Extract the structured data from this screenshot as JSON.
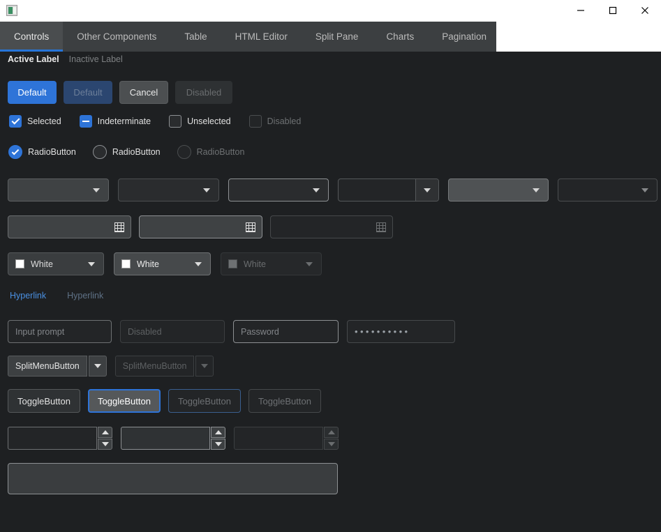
{
  "window": {
    "title": "",
    "icon": "app-window-icon",
    "controls": {
      "minimize": "─",
      "maximize": "□",
      "close": "✕"
    }
  },
  "tabs": [
    {
      "label": "Controls",
      "active": true
    },
    {
      "label": "Other Components",
      "active": false
    },
    {
      "label": "Table",
      "active": false
    },
    {
      "label": "HTML Editor",
      "active": false
    },
    {
      "label": "Split Pane",
      "active": false
    },
    {
      "label": "Charts",
      "active": false
    },
    {
      "label": "Pagination",
      "active": false
    }
  ],
  "labels": {
    "active": "Active Label",
    "inactive": "Inactive Label"
  },
  "buttons": [
    {
      "label": "Default",
      "state": "default"
    },
    {
      "label": "Default",
      "state": "default-disabled"
    },
    {
      "label": "Cancel",
      "state": "cancel"
    },
    {
      "label": "Disabled",
      "state": "disabled"
    }
  ],
  "checkboxes": [
    {
      "label": "Selected",
      "state": "checked"
    },
    {
      "label": "Indeterminate",
      "state": "indeterminate"
    },
    {
      "label": "Unselected",
      "state": "unchecked"
    },
    {
      "label": "Disabled",
      "state": "disabled"
    }
  ],
  "radios": [
    {
      "label": "RadioButton",
      "state": "checked"
    },
    {
      "label": "RadioButton",
      "state": "unchecked"
    },
    {
      "label": "RadioButton",
      "state": "disabled"
    }
  ],
  "combos": [
    {
      "value": "",
      "state": "normal"
    },
    {
      "value": "",
      "state": "flat"
    },
    {
      "value": "",
      "state": "focused"
    },
    {
      "value": "",
      "state": "editable"
    },
    {
      "value": "",
      "state": "hover"
    },
    {
      "value": "",
      "state": "disabled"
    }
  ],
  "datepickers": [
    {
      "value": "",
      "icon": "calendar-icon",
      "state": "normal"
    },
    {
      "value": "",
      "icon": "calendar-icon",
      "state": "focused"
    },
    {
      "value": "",
      "icon": "calendar-icon",
      "state": "disabled"
    }
  ],
  "colorpickers": [
    {
      "value": "White",
      "swatch": "#ffffff",
      "state": "normal"
    },
    {
      "value": "White",
      "swatch": "#ffffff",
      "state": "hover"
    },
    {
      "value": "White",
      "swatch": "#6e7173",
      "state": "disabled"
    }
  ],
  "hyperlinks": [
    {
      "label": "Hyperlink",
      "state": "enabled"
    },
    {
      "label": "Hyperlink",
      "state": "disabled"
    }
  ],
  "textfields": [
    {
      "value": "",
      "placeholder": "Input prompt",
      "state": "normal"
    },
    {
      "value": "",
      "placeholder": "Disabled",
      "state": "disabled"
    },
    {
      "value": "",
      "placeholder": "Password",
      "state": "focused"
    },
    {
      "value": "••••••••••",
      "placeholder": "",
      "state": "password"
    }
  ],
  "splitmenubuttons": [
    {
      "label": "SplitMenuButton",
      "state": "enabled"
    },
    {
      "label": "SplitMenuButton",
      "state": "disabled"
    }
  ],
  "togglebuttons": [
    {
      "label": "ToggleButton",
      "state": "normal"
    },
    {
      "label": "ToggleButton",
      "state": "selected"
    },
    {
      "label": "ToggleButton",
      "state": "selected-disabled"
    },
    {
      "label": "ToggleButton",
      "state": "disabled"
    }
  ],
  "spinners": [
    {
      "value": "",
      "state": "normal"
    },
    {
      "value": "",
      "state": "focused"
    },
    {
      "value": "",
      "state": "disabled"
    }
  ],
  "textarea": {
    "value": "",
    "placeholder": ""
  },
  "colors": {
    "accent": "#2e74d8",
    "background": "#1e2022",
    "tabbar": "#3c3f41",
    "tab_active": "#4a4d4f",
    "link": "#4a90e2",
    "titlebar": "#ffffff"
  }
}
